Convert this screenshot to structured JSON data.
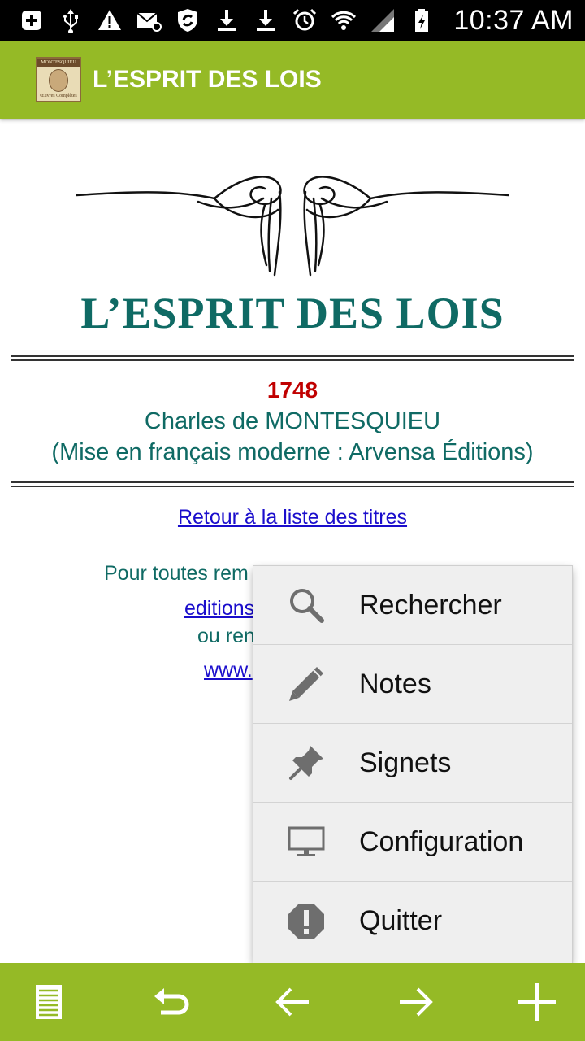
{
  "status_bar": {
    "time": "10:37 AM",
    "icons": [
      "add-box-icon",
      "usb-icon",
      "warning-icon",
      "mail-icon",
      "shield-sync-icon",
      "download-icon",
      "download-icon",
      "alarm-icon",
      "wifi-icon",
      "signal-icon",
      "battery-icon"
    ]
  },
  "action_bar": {
    "title": "L’ESPRIT DES LOIS",
    "logo_text_top": "MONTESQUIEU",
    "logo_text_bottom": "Œuvres Complètes"
  },
  "content": {
    "title": "L’ESPRIT DES LOIS",
    "year": "1748",
    "author": "Charles de MONTESQUIEU",
    "edition": "(Mise en français moderne : Arvensa Éditions)",
    "back_link": "Retour à la liste des titres",
    "note_line1": "Pour toutes rem",
    "mail_link": "editions",
    "note_line2": "ou ren",
    "web_link": "www."
  },
  "menu": {
    "items": [
      {
        "label": "Rechercher",
        "icon": "search-icon"
      },
      {
        "label": "Notes",
        "icon": "pencil-icon"
      },
      {
        "label": "Signets",
        "icon": "pin-icon"
      },
      {
        "label": "Configuration",
        "icon": "monitor-icon"
      },
      {
        "label": "Quitter",
        "icon": "exit-icon"
      }
    ]
  },
  "bottom_bar": {
    "buttons": [
      "toc-icon",
      "undo-icon",
      "back-arrow-icon",
      "forward-arrow-icon",
      "plus-icon"
    ]
  },
  "colors": {
    "accent": "#95ba26",
    "title_teal": "#0f6a64",
    "year_red": "#c00000",
    "link_blue": "#1a0dcc"
  }
}
